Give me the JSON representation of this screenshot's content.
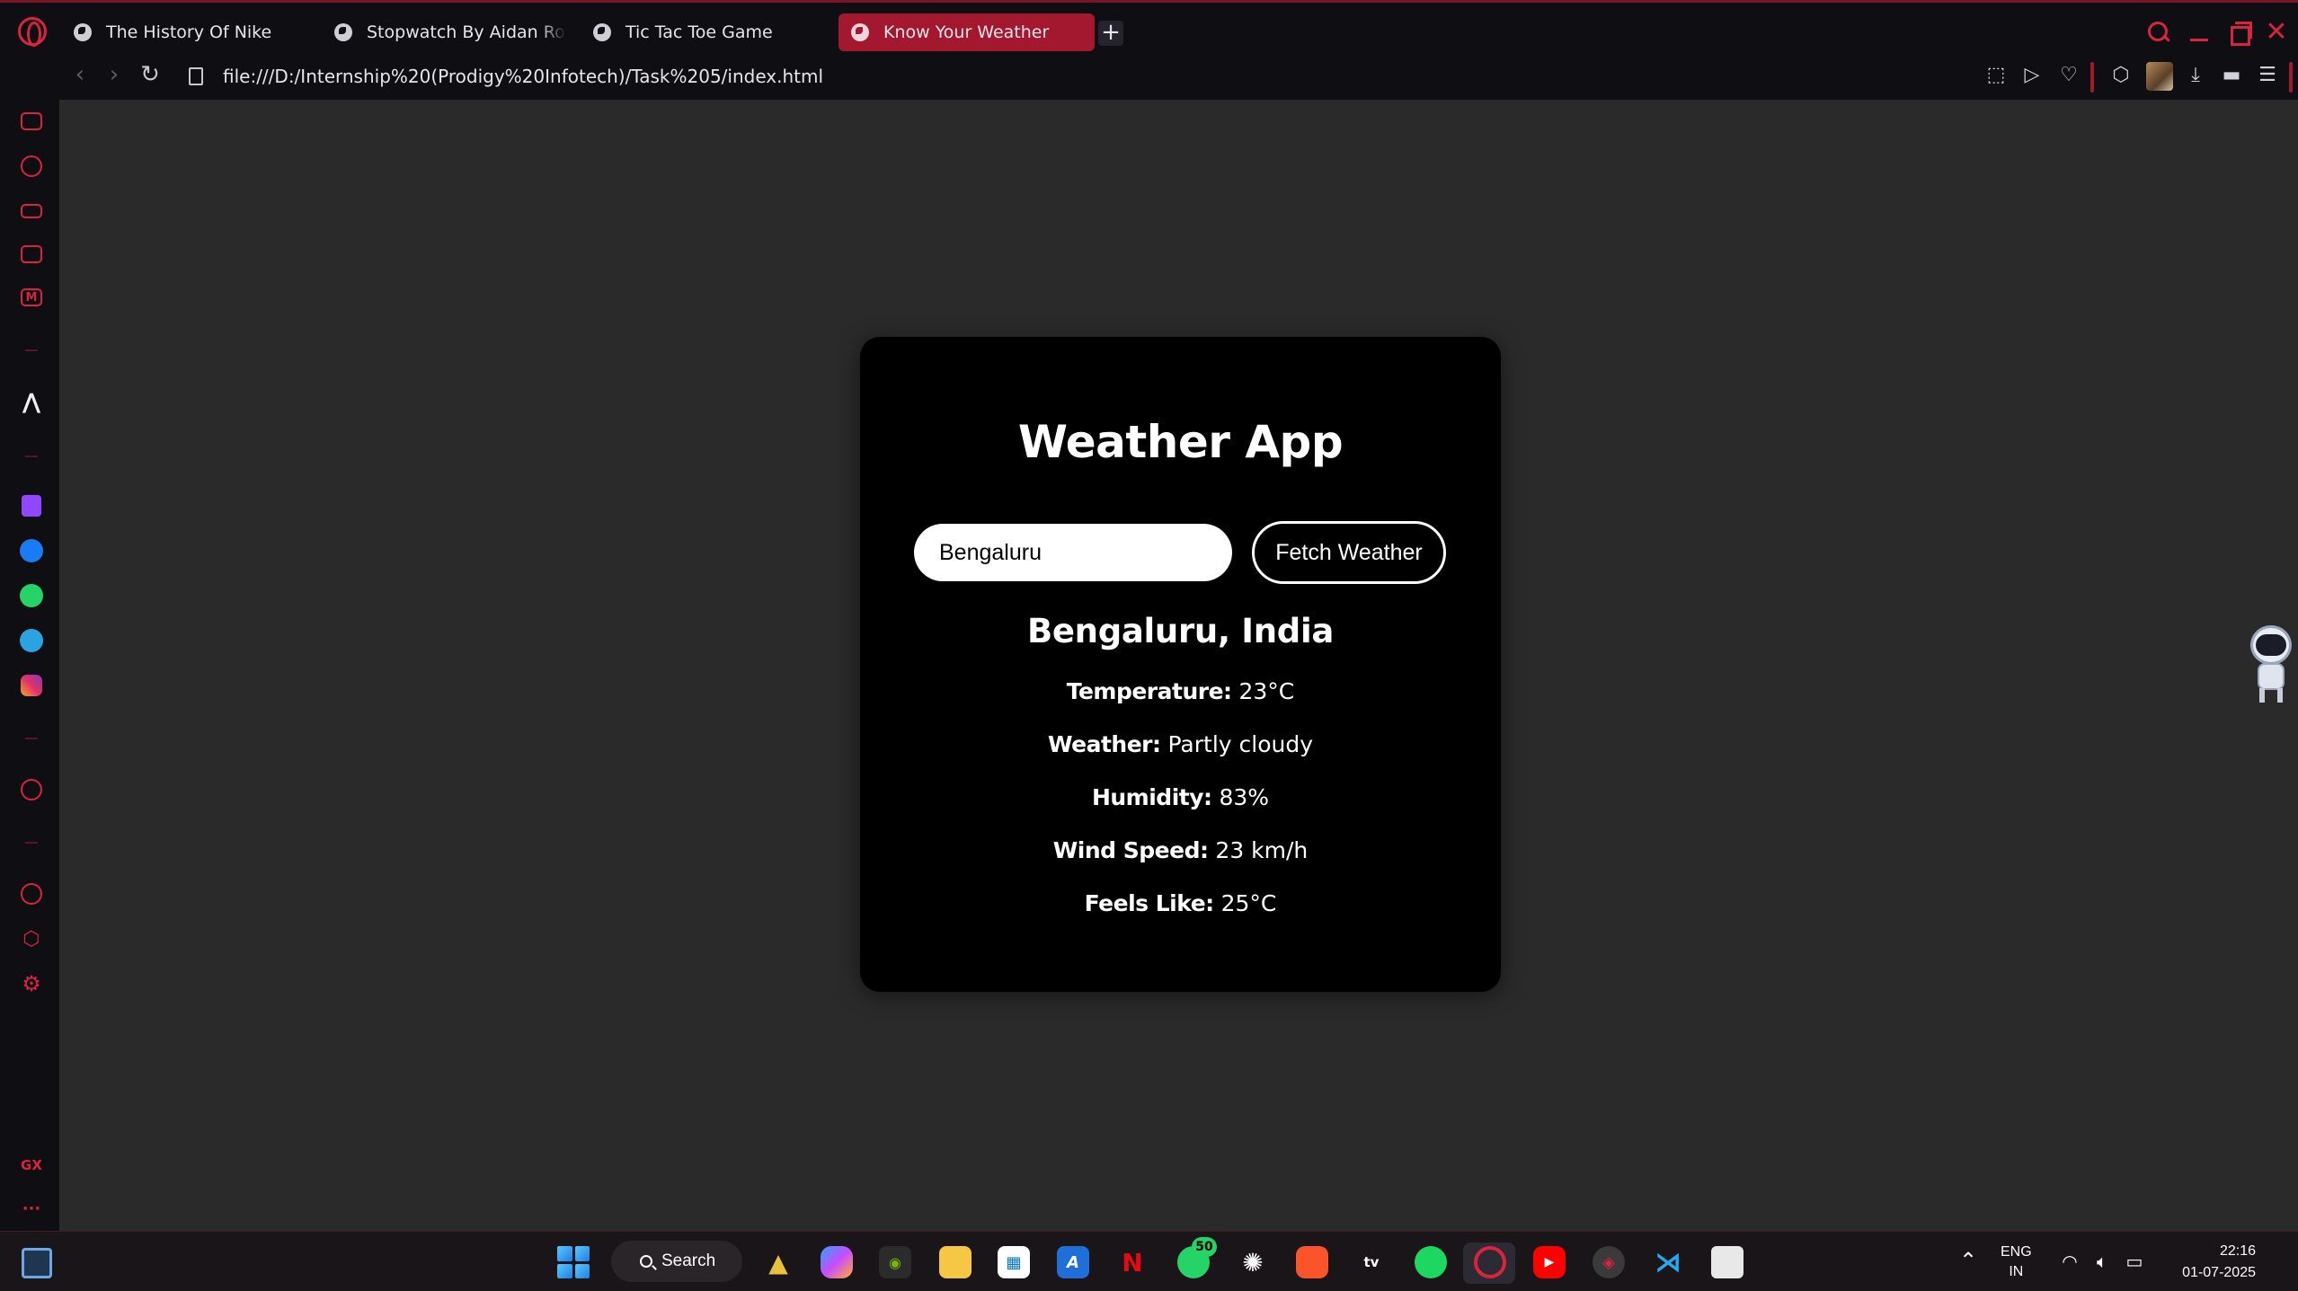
{
  "browser": {
    "tabs": [
      {
        "label": "The History Of Nike",
        "active": false
      },
      {
        "label": "Stopwatch By Aidan Rodrigues",
        "active": false
      },
      {
        "label": "Tic Tac Toe Game",
        "active": false
      },
      {
        "label": "Know Your Weather",
        "active": true
      }
    ],
    "new_tab_label": "+",
    "url": "file:///D:/Internship%20(Prodigy%20Infotech)/Task%205/index.html",
    "accent_color": "#a3182e"
  },
  "sidebar": {
    "bottom_label": "GX",
    "more_label": "···"
  },
  "weather_app": {
    "title": "Weather App",
    "city_input_value": "Bengaluru",
    "fetch_button_label": "Fetch Weather",
    "location": "Bengaluru, India",
    "rows": [
      {
        "label": "Temperature:",
        "value": "23°C"
      },
      {
        "label": "Weather:",
        "value": "Partly cloudy"
      },
      {
        "label": "Humidity:",
        "value": "83%"
      },
      {
        "label": "Wind Speed:",
        "value": "23 km/h"
      },
      {
        "label": "Feels Like:",
        "value": "25°C"
      }
    ]
  },
  "taskbar": {
    "search_label": "Search",
    "whatsapp_badge": "50",
    "lang_line1": "ENG",
    "lang_line2": "IN",
    "time": "22:16",
    "date": "01-07-2025"
  }
}
